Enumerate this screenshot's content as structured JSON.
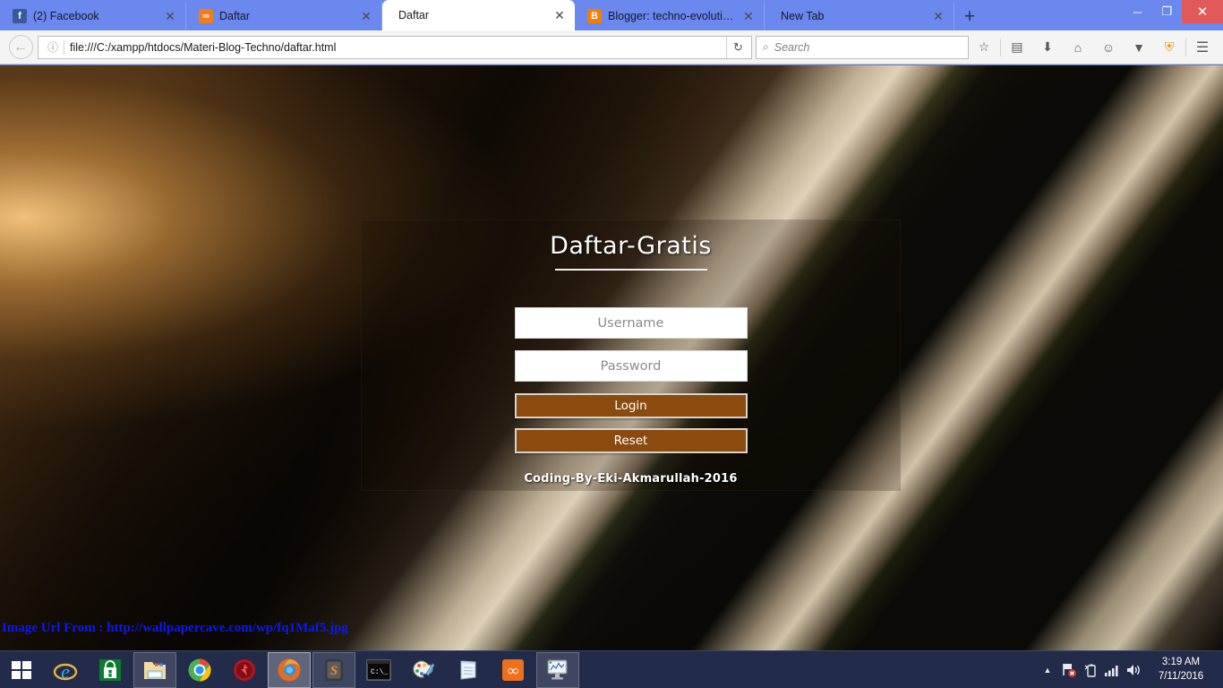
{
  "browser": {
    "tabs": [
      {
        "label": "(2) Facebook",
        "favicon": "facebook-icon",
        "favicon_glyph": "f",
        "active": false
      },
      {
        "label": "Daftar",
        "favicon": "xampp-icon",
        "favicon_glyph": "∞",
        "active": false
      },
      {
        "label": "Daftar",
        "favicon": "none",
        "favicon_glyph": "",
        "active": true
      },
      {
        "label": "Blogger: techno-evolution...",
        "favicon": "blogger-icon",
        "favicon_glyph": "B",
        "active": false
      },
      {
        "label": "New Tab",
        "favicon": "none",
        "favicon_glyph": "",
        "active": false
      }
    ],
    "tab_close_glyph": "✕",
    "new_tab_label": "+",
    "window_controls": {
      "minimize": "─",
      "maximize": "❐",
      "close": "✕"
    },
    "nav": {
      "back_glyph": "←",
      "identity_glyph": "ⓘ",
      "url": "file:///C:/xampp/htdocs/Materi-Blog-Techno/daftar.html",
      "reload_glyph": "↻",
      "search_placeholder": "Search",
      "search_icon_glyph": "⌕",
      "toolbar_icons": [
        {
          "name": "bookmark-star-icon",
          "glyph": "☆"
        },
        {
          "name": "reader-list-icon",
          "glyph": "▤"
        },
        {
          "name": "downloads-icon",
          "glyph": "⬇"
        },
        {
          "name": "home-icon",
          "glyph": "⌂"
        },
        {
          "name": "sync-chat-icon",
          "glyph": "☺"
        },
        {
          "name": "pocket-icon",
          "glyph": "▼"
        },
        {
          "name": "ip-shield-icon",
          "glyph": "⛨"
        },
        {
          "name": "menu-hamburger-icon",
          "glyph": "☰"
        }
      ]
    }
  },
  "page": {
    "card": {
      "title": "Daftar-Gratis",
      "username_placeholder": "Username",
      "password_placeholder": "Password",
      "login_label": "Login",
      "reset_label": "Reset",
      "credit": "Coding-By-Eki-Akmarullah-2016"
    },
    "image_credit": "Image Url From : http://wallpapercave.com/wp/fq1Maf5.jpg",
    "colors": {
      "button_brown": "#8b4a0e",
      "button_border": "#d7d4cd",
      "credit_blue": "#0d19f0",
      "title_white": "#fdfdfd"
    }
  },
  "taskbar": {
    "start_label": "Start",
    "items": [
      {
        "name": "internet-explorer-icon",
        "state": "pinned"
      },
      {
        "name": "windows-store-icon",
        "state": "pinned"
      },
      {
        "name": "file-explorer-icon",
        "state": "pinned-box"
      },
      {
        "name": "google-chrome-icon",
        "state": "pinned"
      },
      {
        "name": "red-app-icon",
        "state": "pinned"
      },
      {
        "name": "firefox-icon",
        "state": "running"
      },
      {
        "name": "sublime-text-icon",
        "state": "pinned-box"
      },
      {
        "name": "command-prompt-icon",
        "state": "pinned"
      },
      {
        "name": "paint-icon",
        "state": "pinned"
      },
      {
        "name": "notepad-icon",
        "state": "pinned"
      },
      {
        "name": "xampp-icon",
        "state": "pinned"
      },
      {
        "name": "resource-monitor-icon",
        "state": "pinned-box"
      }
    ],
    "tray": {
      "show_hidden_glyph": "▲",
      "network_glyph": "⚑",
      "battery_glyph": "▯",
      "signal_glyph": "▂▄▆",
      "volume_glyph": "🔊",
      "time": "3:19 AM",
      "date": "7/11/2016"
    }
  }
}
